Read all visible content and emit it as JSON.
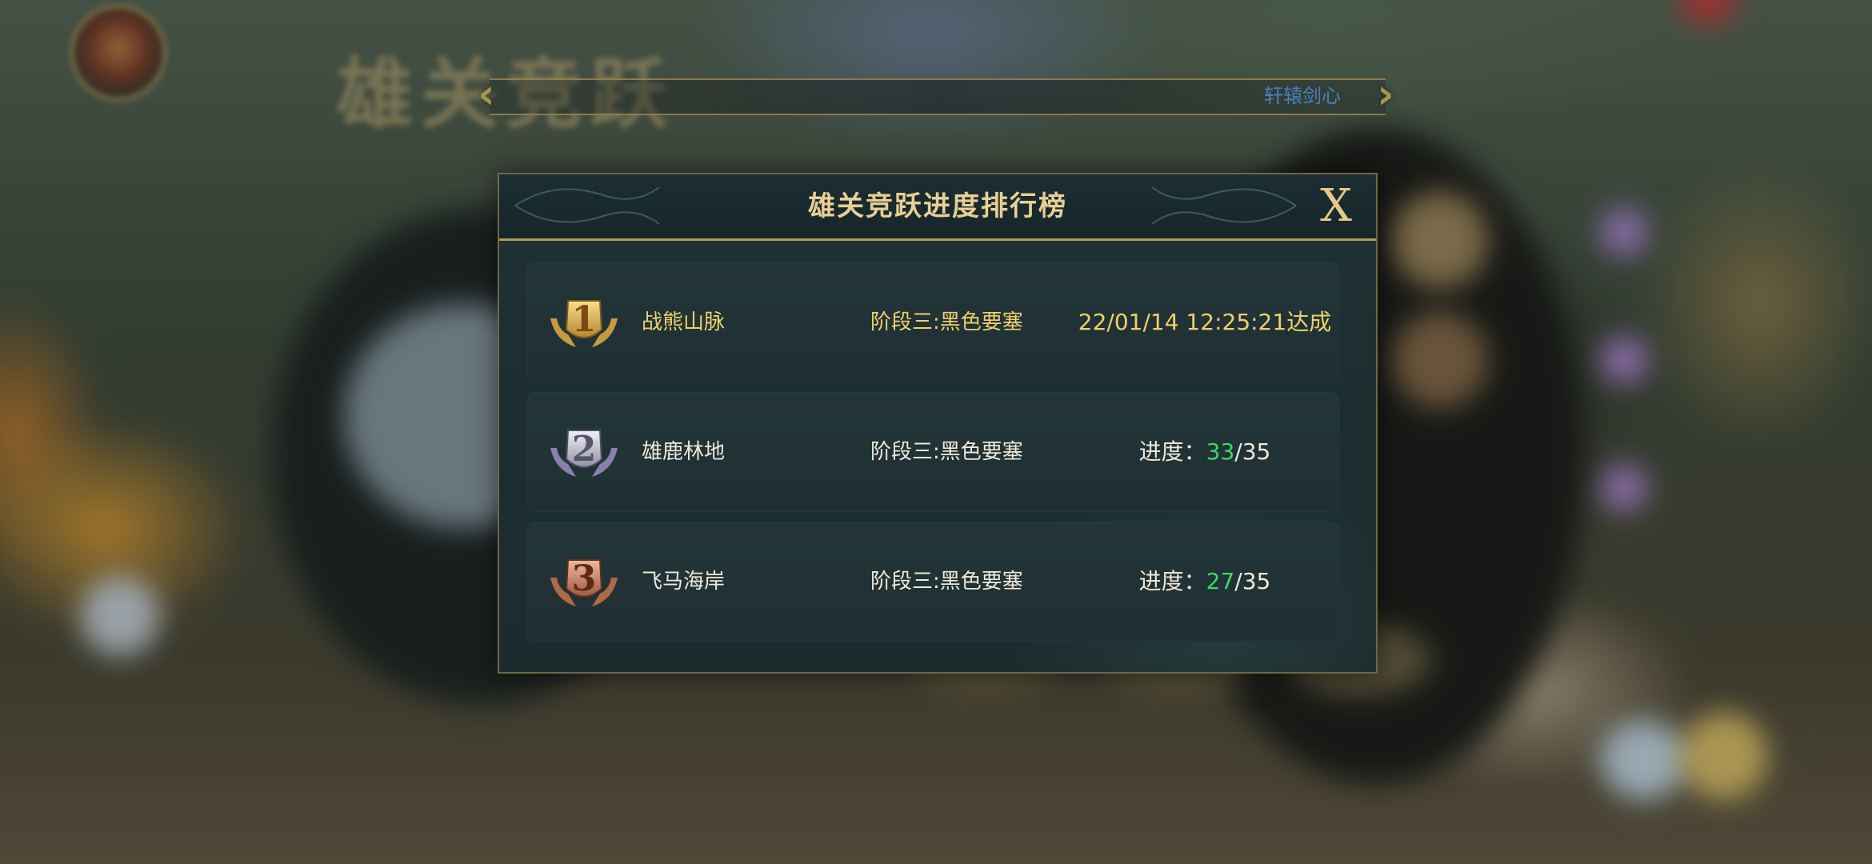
{
  "hud": {
    "player_name": "轩辕剑心",
    "event_title_art": "雄关竞跃"
  },
  "modal": {
    "title": "雄关竞跃进度排行榜",
    "close_label": "X",
    "rows": [
      {
        "rank": "1",
        "medal": "gold",
        "name": "战熊山脉",
        "stage": "阶段三:黑色要塞",
        "completed_at": "22/01/14 12:25:21达成"
      },
      {
        "rank": "2",
        "medal": "silver",
        "name": "雄鹿林地",
        "stage": "阶段三:黑色要塞",
        "progress_label": "进度：",
        "progress_current": "33",
        "progress_total": "/35",
        "progress_value": 33,
        "progress_max": 35
      },
      {
        "rank": "3",
        "medal": "bronze",
        "name": "飞马海岸",
        "stage": "阶段三:黑色要塞",
        "progress_label": "进度：",
        "progress_current": "27",
        "progress_total": "/35",
        "progress_value": 27,
        "progress_max": 35
      }
    ]
  },
  "colors": {
    "gold_text": "#f0cf6b",
    "progress_green": "#3ed76a",
    "title_gold": "#e8cf95",
    "panel_bg": "#1d2f32"
  }
}
